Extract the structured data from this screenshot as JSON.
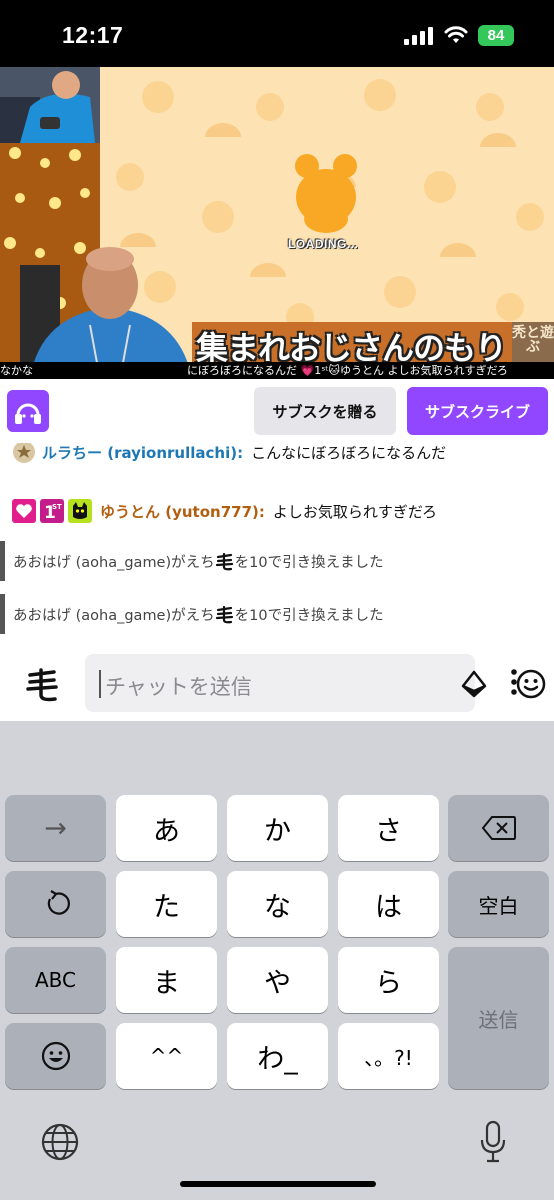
{
  "status_bar": {
    "time": "12:17",
    "battery": "84"
  },
  "stream": {
    "loading_text": "LOADING...",
    "title": "集まれおじさんのもり",
    "logo_text": "秃と遊ぶ",
    "ticker": "なかな　　　　　　　　　　　　　　にぼろぼろになるんだ 💗1ˢᵗ🐱ゆうとん  よしお気取られすぎだろ"
  },
  "toolbar": {
    "gift_sub_label": "サブスクを贈る",
    "subscribe_label": "サブスクライブ"
  },
  "chat": {
    "messages": [
      {
        "username": "ルラちー (rayionrullachi):",
        "text": "こんなにぼろぼろになるんだ"
      },
      {
        "username": "ゆうとん (yuton777):",
        "text": "よしお気取られすぎだろ",
        "badge_sub": "1ST"
      }
    ],
    "system": [
      {
        "pre": "あおはげ (aoha_game)がえち",
        "post": "を10で引き換えました"
      },
      {
        "pre": "あおはげ (aoha_game)がえち",
        "post": "を10で引き換えました"
      }
    ]
  },
  "input": {
    "placeholder": "チャットを送信"
  },
  "keyboard": {
    "rows": [
      [
        "→",
        "あ",
        "か",
        "さ",
        "⌫"
      ],
      [
        "↺",
        "た",
        "な",
        "は",
        "空白"
      ],
      [
        "ABC",
        "ま",
        "や",
        "ら",
        "送信"
      ],
      [
        "☺",
        "^^",
        "わ_",
        "、。?!"
      ]
    ]
  },
  "colors": {
    "accent": "#9147ff",
    "battery": "#34c759",
    "username_blue": "#1e78b4",
    "username_orange": "#b25e0f"
  }
}
